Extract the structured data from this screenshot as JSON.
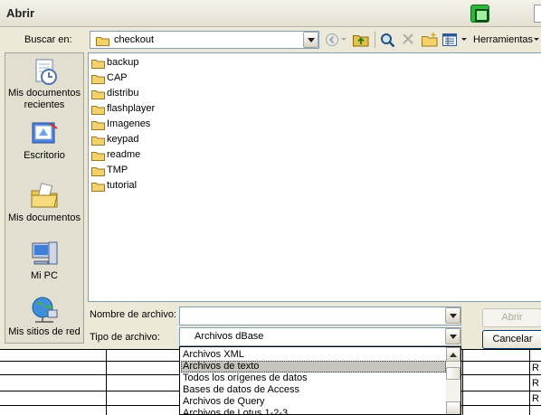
{
  "dialog": {
    "title": "Abrir"
  },
  "lookin": {
    "label": "Buscar en:",
    "value": "checkout"
  },
  "toolbar": {
    "tools_label": "Herramientas"
  },
  "places": [
    {
      "label": "Mis documentos recientes",
      "icon": "recent-documents-icon"
    },
    {
      "label": "Escritorio",
      "icon": "desktop-icon"
    },
    {
      "label": "Mis documentos",
      "icon": "my-documents-icon"
    },
    {
      "label": "Mi PC",
      "icon": "my-computer-icon"
    },
    {
      "label": "Mis sitios de red",
      "icon": "network-places-icon"
    }
  ],
  "files": [
    {
      "name": "backup"
    },
    {
      "name": "CAP"
    },
    {
      "name": "distribu"
    },
    {
      "name": "flashplayer"
    },
    {
      "name": "Imagenes"
    },
    {
      "name": "keypad"
    },
    {
      "name": "readme"
    },
    {
      "name": "TMP"
    },
    {
      "name": "tutorial"
    }
  ],
  "filename": {
    "label": "Nombre de archivo:",
    "value": ""
  },
  "filetype": {
    "label": "Tipo de archivo:",
    "value": "Archivos dBase",
    "options": [
      "Archivos XML",
      "Archivos de texto",
      "Todos los orígenes de datos",
      "Bases de datos de Access",
      "Archivos de Query",
      "Archivos de Lotus 1-2-3"
    ],
    "selected_index": 1
  },
  "buttons": {
    "open": "Abrir",
    "cancel": "Cancelar"
  },
  "sheet": {
    "cell_text": "R"
  },
  "colors": {
    "dialog_bg": "#ece9d8",
    "border_blue": "#7f9db9",
    "folder_yellow": "#f3d26b"
  }
}
